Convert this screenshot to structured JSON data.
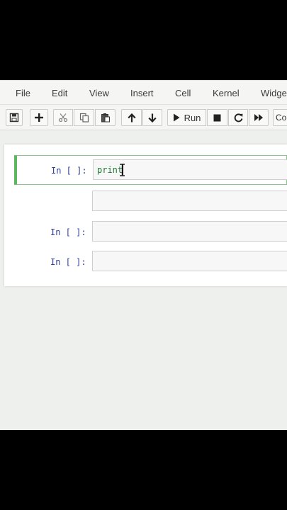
{
  "menu": {
    "items": [
      "File",
      "Edit",
      "View",
      "Insert",
      "Cell",
      "Kernel",
      "Widge"
    ]
  },
  "toolbar": {
    "run_label": "Run",
    "cell_type_label": "Co",
    "icons": [
      "save-icon",
      "plus-icon",
      "scissors-icon",
      "copy-icon",
      "paste-icon",
      "arrow-up-icon",
      "arrow-down-icon",
      "play-icon",
      "stop-icon",
      "restart-icon",
      "fast-forward-icon"
    ]
  },
  "notebook": {
    "cells": [
      {
        "prompt": "In [ ]:",
        "code": "print",
        "selected": true
      },
      {
        "prompt": "",
        "code": "",
        "selected": false
      },
      {
        "prompt": "In [ ]:",
        "code": "",
        "selected": false
      },
      {
        "prompt": "In [ ]:",
        "code": "",
        "selected": false
      }
    ]
  },
  "colors": {
    "selected_border": "#5cb85c",
    "prompt": "#303f9f",
    "code_builtin": "#1d7a37"
  }
}
